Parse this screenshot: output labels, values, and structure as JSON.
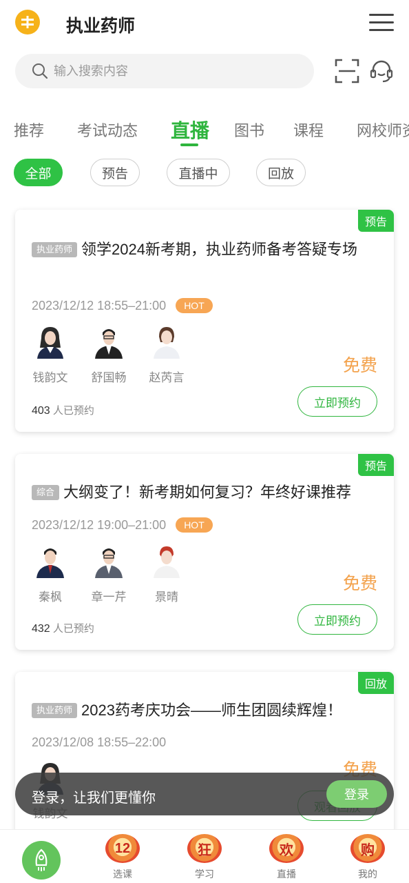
{
  "header": {
    "title": "执业药师"
  },
  "search": {
    "placeholder": "输入搜索内容"
  },
  "tabs": [
    "推荐",
    "考试动态",
    "直播",
    "图书",
    "课程",
    "网校师资"
  ],
  "filters": [
    "全部",
    "预告",
    "直播中",
    "回放"
  ],
  "cards": [
    {
      "badge": "预告",
      "category": "执业药师",
      "title": "领学2024新考期，执业药师备考答疑专场",
      "time": "2023/12/12 18:55–21:00",
      "hot": "HOT",
      "teachers": [
        "钱韵文",
        "舒国畅",
        "赵芮言"
      ],
      "price": "免费",
      "count": "403",
      "count_suffix": "人已预约",
      "action": "立即预约"
    },
    {
      "badge": "预告",
      "category": "综合",
      "title": "大纲变了！新考期如何复习？年终好课推荐",
      "time": "2023/12/12 19:00–21:00",
      "hot": "HOT",
      "teachers": [
        "秦枫",
        "章一芹",
        "景晴"
      ],
      "price": "免费",
      "count": "432",
      "count_suffix": "人已预约",
      "action": "立即预约"
    },
    {
      "badge": "回放",
      "category": "执业药师",
      "title": "2023药考庆功会——师生团圆续辉煌！",
      "time": "2023/12/08 18:55–22:00",
      "teachers": [
        "钱韵文"
      ],
      "price": "免费",
      "action": "观看回放"
    }
  ],
  "toast": {
    "text": "登录，让我们更懂你",
    "button": "登录"
  },
  "bottom_nav": [
    {
      "badge": "12",
      "label": "选课"
    },
    {
      "badge": "狂",
      "label": "学习"
    },
    {
      "badge": "欢",
      "label": "直播"
    },
    {
      "badge": "购",
      "label": "我的"
    }
  ]
}
